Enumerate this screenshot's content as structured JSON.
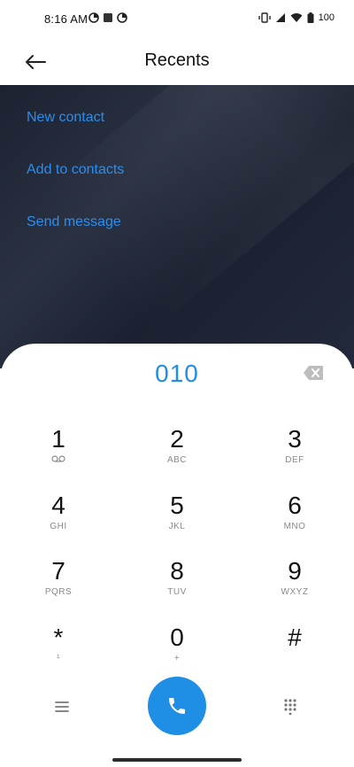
{
  "status_bar": {
    "time": "8:16 AM",
    "left_icons": [
      "data-saver-icon",
      "square-app-icon",
      "data-saver-icon"
    ],
    "right_icons": [
      "vibrate-icon",
      "signal-icon",
      "wifi-icon",
      "battery-icon"
    ],
    "battery": "100"
  },
  "app_bar": {
    "title": "Recents",
    "back_icon": "arrow-left-icon"
  },
  "actions": [
    {
      "label": "New contact"
    },
    {
      "label": "Add to contacts"
    },
    {
      "label": "Send message"
    }
  ],
  "dialpad": {
    "number": "010",
    "backspace_icon": "backspace-icon",
    "keys": [
      {
        "digit": "1",
        "letters": "",
        "icon": "voicemail-icon"
      },
      {
        "digit": "2",
        "letters": "ABC"
      },
      {
        "digit": "3",
        "letters": "DEF"
      },
      {
        "digit": "4",
        "letters": "GHI"
      },
      {
        "digit": "5",
        "letters": "JKL"
      },
      {
        "digit": "6",
        "letters": "MNO"
      },
      {
        "digit": "7",
        "letters": "PQRS"
      },
      {
        "digit": "8",
        "letters": "TUV"
      },
      {
        "digit": "9",
        "letters": "WXYZ"
      },
      {
        "digit": "*",
        "letters": "¹"
      },
      {
        "digit": "0",
        "letters": "+"
      },
      {
        "digit": "#",
        "letters": ""
      }
    ],
    "bottom": {
      "menu_icon": "menu-icon",
      "call_icon": "phone-icon",
      "grid_icon": "dialpad-grid-icon"
    }
  },
  "colors": {
    "accent": "#1f8fe6",
    "panel_dark": "#1c2230"
  }
}
